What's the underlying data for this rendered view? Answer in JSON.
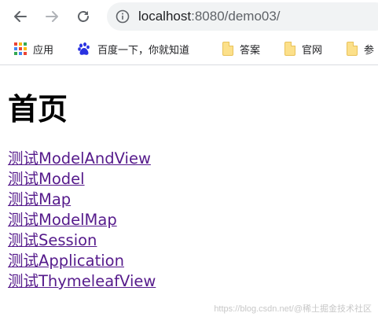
{
  "browser": {
    "url_host": "localhost",
    "url_rest": ":8080/demo03/",
    "icons": {
      "back": "back-arrow-icon",
      "forward": "forward-arrow-icon",
      "reload": "reload-icon",
      "info": "info-icon"
    },
    "colors": {
      "toolbar_icon": "#5f6368",
      "forward_disabled": "#b0b3b8",
      "omnibox_bg": "#f1f3f4"
    }
  },
  "bookmarks": [
    {
      "label": "应用",
      "icon": "apps-grid-icon"
    },
    {
      "label": "百度一下，你就知道",
      "icon": "baidu-paw-icon"
    },
    {
      "label": "答案",
      "icon": "folder-icon"
    },
    {
      "label": "官网",
      "icon": "folder-icon"
    },
    {
      "label": "参",
      "icon": "folder-icon"
    }
  ],
  "page": {
    "title": "首页",
    "links": [
      {
        "label": "测试ModelAndView"
      },
      {
        "label": "测试Model"
      },
      {
        "label": "测试Map"
      },
      {
        "label": "测试ModelMap"
      },
      {
        "label": "测试Session"
      },
      {
        "label": "测试Application"
      },
      {
        "label": "测试ThymeleafView"
      }
    ],
    "link_color": "#551a8b",
    "watermark": "https://blog.csdn.net/@稀土掘金技术社区"
  }
}
